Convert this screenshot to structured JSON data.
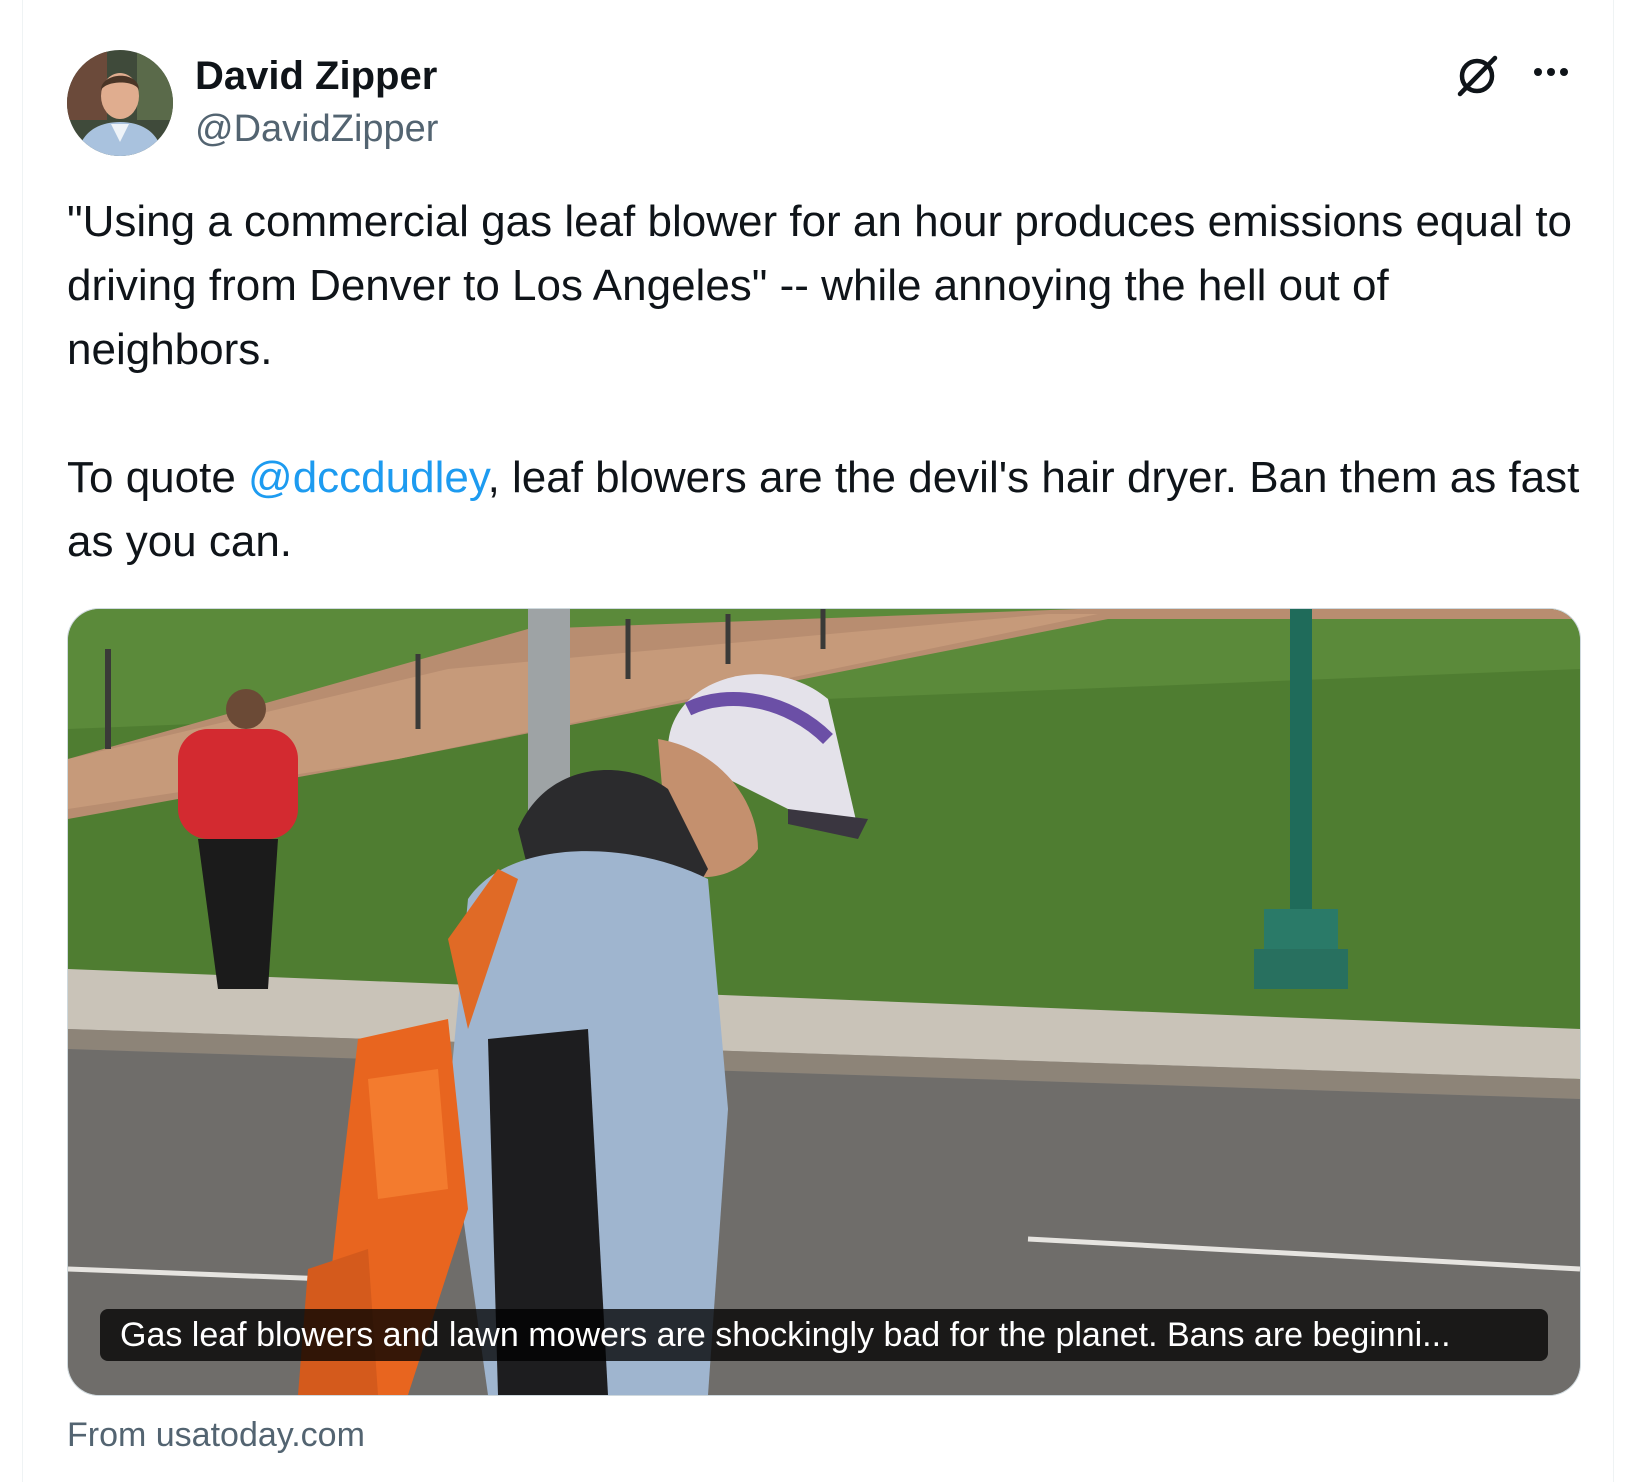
{
  "tweet": {
    "author_name": "David Zipper",
    "author_handle": "@DavidZipper",
    "paragraph1": "\"Using a commercial gas leaf blower for an hour produces emissions equal to driving from Denver to Los Angeles\" -- while annoying the hell out of neighbors.",
    "paragraph2_before": "To quote ",
    "mention": "@dccdudley",
    "paragraph2_after": ", leaf blowers are the devil's hair dryer. Ban them as fast as you can."
  },
  "card": {
    "caption": "Gas leaf blowers and lawn mowers are shockingly bad for the planet. Bans are beginni...",
    "source": "From usatoday.com"
  },
  "icons": {
    "grok": "grok-icon",
    "more": "more-options-icon"
  },
  "colors": {
    "mention": "#1d9bf0",
    "secondary_text": "#536471"
  }
}
